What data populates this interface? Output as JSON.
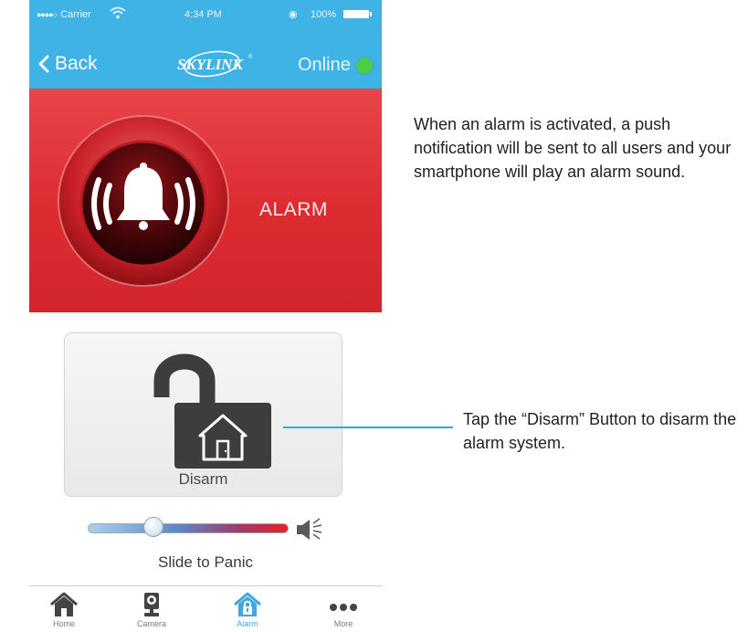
{
  "status_bar": {
    "signal": "●●●●○",
    "carrier": "Carrier",
    "time": "4:34 PM",
    "battery_pct": "100%"
  },
  "nav": {
    "back_label": "Back",
    "logo_text": "SKYLINK",
    "status_label": "Online",
    "status_color": "#4ccd4a"
  },
  "alarm": {
    "label": "ALARM",
    "icon": "alarm-bell-icon",
    "panel_color": "#dc2c32"
  },
  "disarm": {
    "label": "Disarm",
    "icon": "open-lock-house-icon"
  },
  "panic": {
    "caption": "Slide to Panic",
    "slider_level": 0.28,
    "icon": "speaker-icon"
  },
  "tabs": [
    {
      "label": "Home",
      "icon": "home-icon",
      "active": false
    },
    {
      "label": "Camera",
      "icon": "camera-icon",
      "active": false
    },
    {
      "label": "Alarm",
      "icon": "alarm-house-icon",
      "active": true
    },
    {
      "label": "More",
      "icon": "more-icon",
      "active": false
    }
  ],
  "annotations": {
    "alarm_note": "When an alarm is activated, a push notification will be sent to all users and your smartphone will play an alarm sound.",
    "disarm_note": "Tap the “Disarm” Button to disarm the alarm system."
  },
  "colors": {
    "header": "#3fb3e6",
    "accent": "#2eaadc"
  }
}
